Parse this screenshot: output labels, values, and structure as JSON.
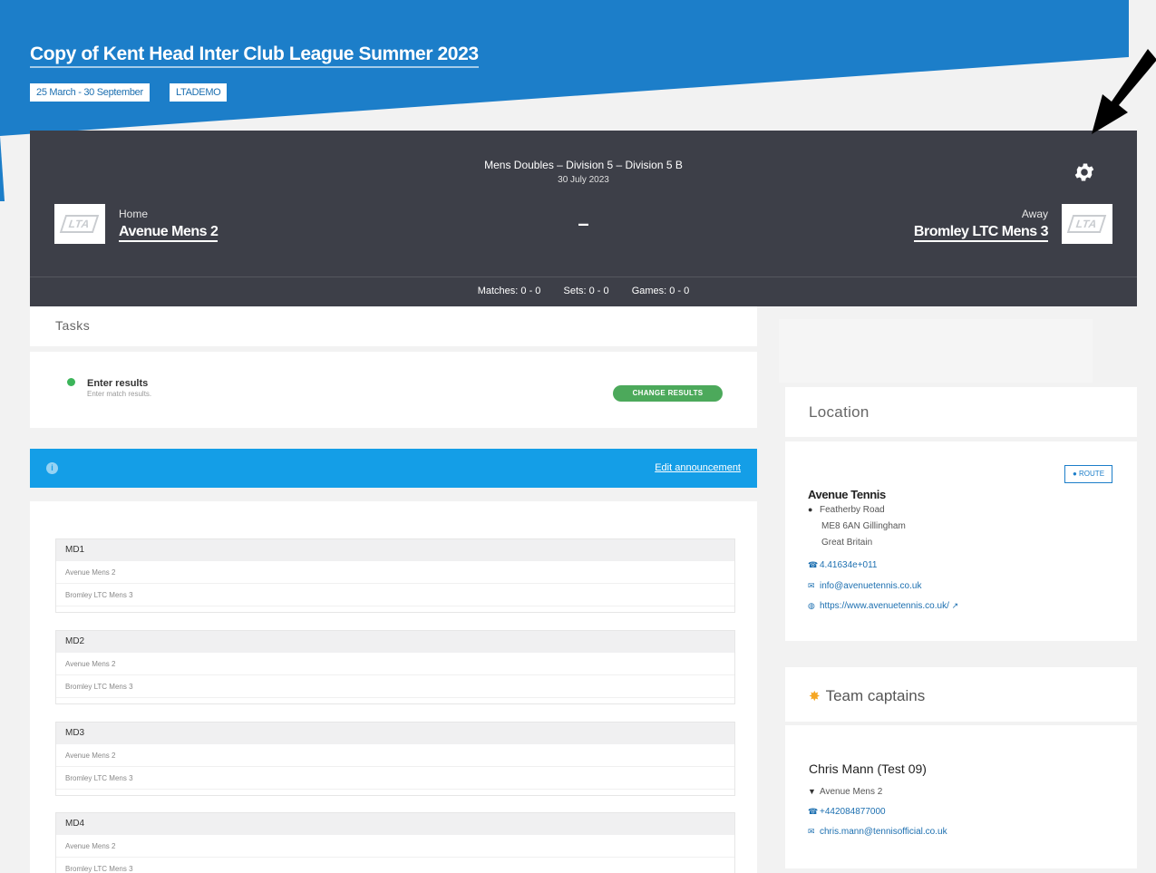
{
  "league": {
    "title": "Copy of Kent Head Inter Club League Summer 2023",
    "date_range": "25 March - 30 September",
    "code": "LTADEMO"
  },
  "match": {
    "competition": "Mens Doubles – Division 5 – Division 5 B",
    "date": "30 July 2023",
    "home_label": "Home",
    "home_team": "Avenue Mens 2",
    "away_label": "Away",
    "away_team": "Bromley LTC Mens 3",
    "logo_text": "LTA",
    "score": "–",
    "stats": {
      "matches": "Matches: 0 - 0",
      "sets": "Sets: 0 - 0",
      "games": "Games: 0 - 0"
    }
  },
  "tasks": {
    "header": "Tasks",
    "items": [
      {
        "title": "Enter results",
        "subtitle": "Enter match results.",
        "button": "CHANGE RESULTS"
      }
    ]
  },
  "announcement": {
    "info_glyph": "i",
    "edit_link": "Edit announcement"
  },
  "rubbers": [
    {
      "name": "MD1",
      "home": "Avenue Mens 2",
      "away": "Bromley LTC Mens 3"
    },
    {
      "name": "MD2",
      "home": "Avenue Mens 2",
      "away": "Bromley LTC Mens 3"
    },
    {
      "name": "MD3",
      "home": "Avenue Mens 2",
      "away": "Bromley LTC Mens 3"
    },
    {
      "name": "MD4",
      "home": "Avenue Mens 2",
      "away": "Bromley LTC Mens 3"
    }
  ],
  "location": {
    "header": "Location",
    "route_button": "ROUTE",
    "venue": "Avenue Tennis",
    "street": "Featherby Road",
    "postcode_city": "ME8 6AN Gillingham",
    "country": "Great Britain",
    "phone": "4.41634e+011",
    "email": "info@avenuetennis.co.uk",
    "website": "https://www.avenuetennis.co.uk/"
  },
  "captains": {
    "header": "Team captains",
    "items": [
      {
        "name": "Chris Mann (Test 09)",
        "team": "Avenue Mens 2",
        "phone": "+442084877000",
        "email": "chris.mann@tennisofficial.co.uk"
      }
    ]
  },
  "icons": {
    "settings": "gear-icon",
    "location_pin": "map-pin-icon",
    "phone": "phone-icon",
    "email": "envelope-icon",
    "web": "globe-icon",
    "external": "external-link-icon",
    "team": "shirt-icon",
    "captains": "people-icon"
  },
  "colors": {
    "header_blue": "#1c7ec9",
    "match_card": "#3d3f48",
    "announcement": "#149ee7",
    "success_green": "#4ca95b",
    "annotation_arrow": "#000000"
  }
}
